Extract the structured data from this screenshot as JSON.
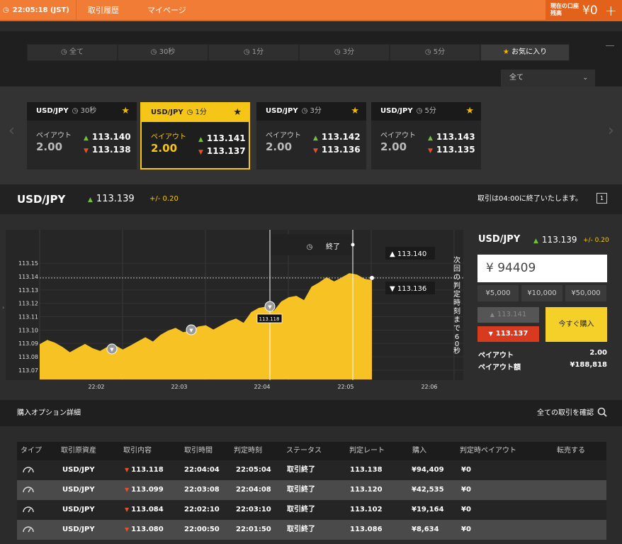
{
  "topbar": {
    "clock": "22:05:18 (JST)",
    "nav": [
      "取引履歴",
      "マイページ"
    ],
    "balance_label": "現在の口座残高",
    "balance_value": "¥0",
    "add": "+"
  },
  "filter": {
    "tabs": [
      "全て",
      "30秒",
      "1分",
      "3分",
      "5分",
      "お気に入り"
    ],
    "select_value": "全て"
  },
  "cards": [
    {
      "pair": "USD/JPY",
      "time": "30秒",
      "payout_label": "ペイアウト",
      "payout": "2.00",
      "high": "113.140",
      "low": "113.138",
      "active": false
    },
    {
      "pair": "USD/JPY",
      "time": "1分",
      "payout_label": "ペイアウト",
      "payout": "2.00",
      "high": "113.141",
      "low": "113.137",
      "active": true
    },
    {
      "pair": "USD/JPY",
      "time": "3分",
      "payout_label": "ペイアウト",
      "payout": "2.00",
      "high": "113.142",
      "low": "113.136",
      "active": false
    },
    {
      "pair": "USD/JPY",
      "time": "5分",
      "payout_label": "ペイアウト",
      "payout": "2.00",
      "high": "113.143",
      "low": "113.135",
      "active": false
    }
  ],
  "ticker": {
    "pair": "USD/JPY",
    "rate": "113.139",
    "change": "+/- 0.20",
    "notice": "取引は04:00に終了いたします。"
  },
  "chart_data": {
    "type": "area",
    "y_ticks": [
      "113.15",
      "113.14",
      "113.13",
      "113.12",
      "113.11",
      "113.10",
      "113.09",
      "113.08",
      "113.07"
    ],
    "ylim": [
      113.063,
      113.157
    ],
    "x_ticks": [
      "22:02",
      "22:03",
      "22:04",
      "22:05",
      "22:06"
    ],
    "series": [
      {
        "values": [
          113.091,
          113.089,
          113.085,
          113.088,
          113.086,
          113.087,
          113.09,
          113.093,
          113.098,
          113.1,
          113.101,
          113.102,
          113.105,
          113.107,
          113.115,
          113.116,
          113.123,
          113.124,
          113.134,
          113.138,
          113.141,
          113.14,
          113.139
        ]
      }
    ],
    "entry_marks": [
      "",
      "",
      "113.118"
    ],
    "end_label": "終了",
    "high_label": "113.140",
    "low_label": "113.136",
    "countdown": "次回の判定時刻まで60秒"
  },
  "panel": {
    "pair": "USD/JPY",
    "rate": "113.139",
    "change": "+/- 0.20",
    "amount": "¥ 94409",
    "quick": [
      "¥5,000",
      "¥10,000",
      "¥50,000"
    ],
    "high_btn": "113.141",
    "low_btn": "113.137",
    "buy_btn": "今すぐ購入",
    "payout_label": "ペイアウト",
    "payout_value": "2.00",
    "payout_amount_label": "ペイアウト額",
    "payout_amount_value": "¥188,818"
  },
  "history": {
    "title": "購入オプション詳細",
    "all_link": "全ての取引を確認",
    "columns": [
      "タイプ",
      "取引原資産",
      "取引内容",
      "取引時間",
      "判定時刻",
      "ステータス",
      "判定レート",
      "購入",
      "判定時ペイアウト",
      "転売する"
    ],
    "rows": [
      {
        "asset": "USD/JPY",
        "content": "113.118",
        "trade_time": "22:04:04",
        "judge_time": "22:05:04",
        "status": "取引終了",
        "rate": "113.138",
        "purchase": "¥94,409",
        "payout": "¥0"
      },
      {
        "asset": "USD/JPY",
        "content": "113.099",
        "trade_time": "22:03:08",
        "judge_time": "22:04:08",
        "status": "取引終了",
        "rate": "113.120",
        "purchase": "¥42,535",
        "payout": "¥0"
      },
      {
        "asset": "USD/JPY",
        "content": "113.084",
        "trade_time": "22:02:10",
        "judge_time": "22:03:10",
        "status": "取引終了",
        "rate": "113.102",
        "purchase": "¥19,164",
        "payout": "¥0"
      },
      {
        "asset": "USD/JPY",
        "content": "113.080",
        "trade_time": "22:00:50",
        "judge_time": "22:01:50",
        "status": "取引終了",
        "rate": "113.086",
        "purchase": "¥8,634",
        "payout": "¥0"
      }
    ]
  }
}
